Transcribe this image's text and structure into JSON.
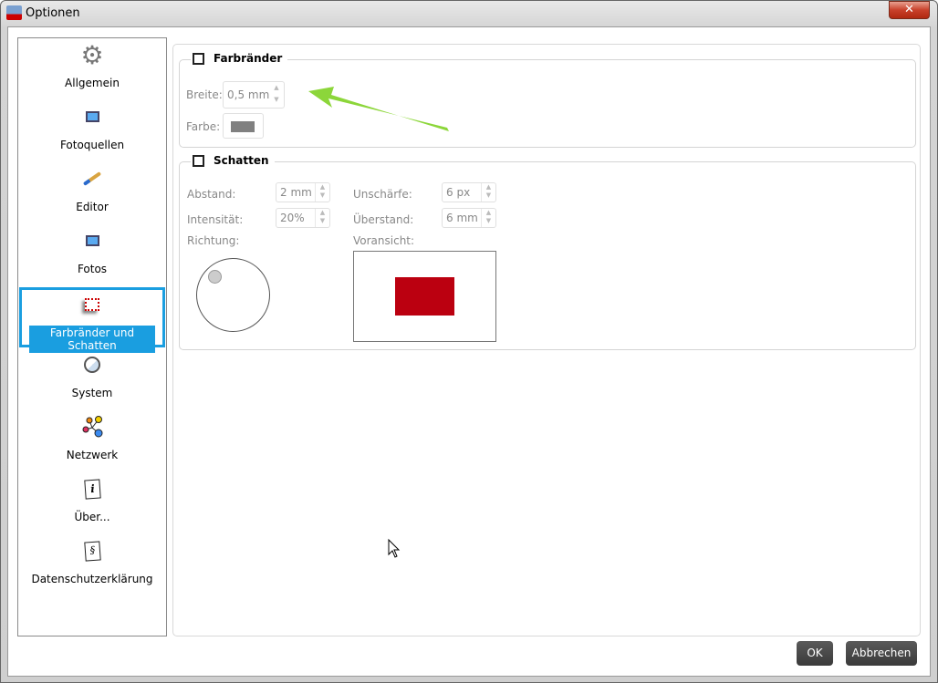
{
  "window": {
    "title": "Optionen",
    "close": "✕"
  },
  "sidebar": {
    "items": [
      {
        "label": "Allgemein",
        "icon": "gear-icon"
      },
      {
        "label": "Fotoquellen",
        "icon": "picture-icon"
      },
      {
        "label": "Editor",
        "icon": "brush-icon"
      },
      {
        "label": "Fotos",
        "icon": "picture-icon"
      },
      {
        "label": "Farbränder und Schatten",
        "icon": "border-shadow-icon",
        "selected": true
      },
      {
        "label": "System",
        "icon": "system-icon"
      },
      {
        "label": "Netzwerk",
        "icon": "network-icon"
      },
      {
        "label": "Über...",
        "icon": "info-icon"
      },
      {
        "label": "Datenschutzerklärung",
        "icon": "paragraph-icon"
      }
    ]
  },
  "borders": {
    "title": "Farbränder",
    "checked": false,
    "width_label": "Breite:",
    "width_value": "0,5 mm",
    "color_label": "Farbe:",
    "color": "#808080"
  },
  "shadow": {
    "title": "Schatten",
    "checked": false,
    "distance_label": "Abstand:",
    "distance_value": "2 mm",
    "intensity_label": "Intensität:",
    "intensity_value": "20%",
    "blur_label": "Unschärfe:",
    "blur_value": "6 px",
    "overhang_label": "Überstand:",
    "overhang_value": "6 mm",
    "direction_label": "Richtung:",
    "preview_label": "Voransicht:",
    "preview_color": "#bb0010"
  },
  "buttons": {
    "ok": "OK",
    "cancel": "Abbrechen"
  }
}
